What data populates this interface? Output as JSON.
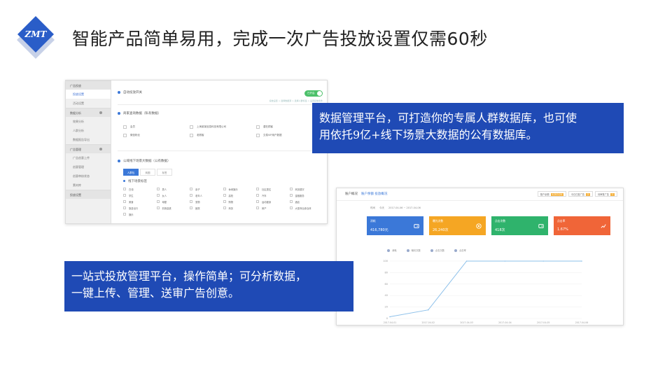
{
  "logo_text": "ZMT",
  "title": "智能产品简单易用，完成一次广告投放设置仅需60秒",
  "callout_data": {
    "line1": "数据管理平台，可打造你的专属人群数据库，也可使",
    "line2": "用依托9亿+线下场景大数据的公有数据库。"
  },
  "callout_ad": {
    "line1": "一站式投放管理平台，操作简单；可分析数据，",
    "line2": "一键上传、管理、送审广告创意。"
  },
  "colors": {
    "callout_blue": "#1f4ab5",
    "logo_blue": "#2a5dc8",
    "card_blue": "#3b78d8",
    "card_orange": "#f5a623",
    "card_green": "#2fb36c",
    "card_red": "#f06538"
  },
  "screenshot1": {
    "sidebar": [
      {
        "label": "广告投放",
        "type": "group"
      },
      {
        "label": "投放设置",
        "type": "active"
      },
      {
        "label": "活动设置",
        "type": "item"
      },
      {
        "label": "数据分析",
        "type": "group"
      },
      {
        "label": "效果分析",
        "type": "item"
      },
      {
        "label": "人群分析",
        "type": "item"
      },
      {
        "label": "数据报告导出",
        "type": "item"
      },
      {
        "label": "广告管理",
        "type": "group"
      },
      {
        "label": "广告创意上传",
        "type": "item"
      },
      {
        "label": "创意管理",
        "type": "item"
      },
      {
        "label": "创意审核状态",
        "type": "item"
      },
      {
        "label": "素材库",
        "type": "item"
      },
      {
        "label": "投放设置",
        "type": "group"
      }
    ],
    "switch_label": "自动投放开关",
    "switch_state": "已开启",
    "breadcrumb": "投放设置 > 选择数据源 > 选择人群标签 > 设置投放条件",
    "private_db_label": "商家查询数据（私有数据）",
    "private_items": [
      "会员",
      "上海某某信息科技有限公司",
      "潜在顾客",
      "微信粉丝",
      "老顾客",
      "交易VIP用户数据"
    ],
    "public_db_label": "公域线下场景大数据（公有数据）",
    "tabs": [
      "人群包",
      "商圈",
      "标签"
    ],
    "tag_group_label": "线下场景标签",
    "public_tags": [
      "白领",
      "男人",
      "亲子",
      "休闲娱乐",
      "社区居住",
      "商务楼宇",
      "学生",
      "女人",
      "老年人",
      "高校",
      "汽车",
      "金融服务",
      "美食",
      "母婴",
      "宠物",
      "购物",
      "运动健身",
      "酒店",
      "旅游出行",
      "机场高铁",
      "医院",
      "商务",
      "房产",
      "大型商业综合体",
      "娱乐"
    ]
  },
  "screenshot2": {
    "title": "账户概况",
    "subtitle": "账户余额 投放概况",
    "badges": [
      {
        "label": "账户余额",
        "value": "4,513.20"
      },
      {
        "label": "今日已投广告",
        "value": "2"
      },
      {
        "label": "待审核广告",
        "value": "1"
      }
    ],
    "filter": [
      "时间",
      "今天",
      "2017-04-06 ~ 2017-04-06"
    ],
    "cards": [
      {
        "label": "消耗",
        "value": "416,780元"
      },
      {
        "label": "曝光次数",
        "value": "26,240次"
      },
      {
        "label": "点击次数",
        "value": "418次"
      },
      {
        "label": "点击率",
        "value": "1.67%"
      }
    ],
    "legend": [
      "消耗",
      "曝光次数",
      "点击次数",
      "点击率"
    ]
  },
  "chart_data": {
    "type": "line",
    "x": [
      "2017-04-01",
      "2017-04-02",
      "2017-04-03",
      "2017-04-04",
      "2017-04-05",
      "2017-04-06"
    ],
    "yticks": [
      "100",
      "80",
      "60",
      "40",
      "20",
      "0"
    ],
    "series": [
      {
        "values": [
          3,
          15,
          100,
          100,
          100,
          100
        ]
      }
    ],
    "ylim": [
      0,
      100
    ]
  }
}
